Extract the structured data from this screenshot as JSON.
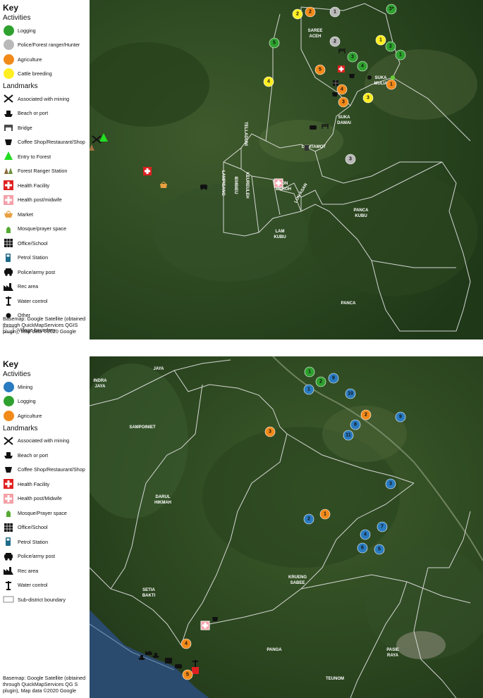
{
  "top": {
    "key_title": "Key",
    "activities_title": "Activities",
    "activities": [
      {
        "label": "Logging",
        "color": "#2ea12e"
      },
      {
        "label": "Police/Forest ranger/Hunter",
        "color": "#b9b9b9"
      },
      {
        "label": "Agriculture",
        "color": "#f28a1a"
      },
      {
        "label": "Cattle breeding",
        "color": "#ffee22"
      }
    ],
    "landmarks_title": "Landmarks",
    "landmarks": [
      {
        "label": "Associated with mining",
        "icon": "pickaxe-icon"
      },
      {
        "label": "Beach or port",
        "icon": "ship-icon"
      },
      {
        "label": "Bridge",
        "icon": "bridge-icon"
      },
      {
        "label": "Coffee Shop/Restaurant/Shop",
        "icon": "cup-icon"
      },
      {
        "label": "Entry to Forest",
        "icon": "tree-icon"
      },
      {
        "label": "Forest Ranger Station",
        "icon": "ranger-station-icon"
      },
      {
        "label": "Health Facility",
        "icon": "red-cross-icon"
      },
      {
        "label": "Health post/midwife",
        "icon": "pink-cross-icon"
      },
      {
        "label": "Market",
        "icon": "basket-icon"
      },
      {
        "label": "Mosque/prayer space",
        "icon": "mosque-icon"
      },
      {
        "label": "Office/School",
        "icon": "building-icon"
      },
      {
        "label": "Petrol Station",
        "icon": "fuel-icon"
      },
      {
        "label": "Police/army post",
        "icon": "car-icon"
      },
      {
        "label": "Rec area",
        "icon": "factory-icon"
      },
      {
        "label": "Water control",
        "icon": "tower-icon"
      },
      {
        "label": "Other",
        "icon": "dot-icon"
      },
      {
        "label": "Village boundary",
        "icon": "boundary-icon"
      }
    ],
    "basemap_note": "Basemap: Google Satellite (obtained through QuickMapServices QGIS plugin), Map data ©2020 Google",
    "village_labels": [
      "SAREE ACEH",
      "SUKA MULIA",
      "SUKA DAMAI",
      "LAMTAMOT",
      "TELLADUNI",
      "LAMPISANG",
      "IEMBIEU",
      "KEUREULEH",
      "LON BAROH",
      "LON ASAN",
      "PANCA KUBU",
      "LAM KUBU",
      "PANCA"
    ],
    "markers": [
      {
        "n": "1",
        "cat": "police"
      },
      {
        "n": "2",
        "cat": "agri"
      },
      {
        "n": "2",
        "cat": "cattle"
      },
      {
        "n": "3*",
        "cat": "logging"
      },
      {
        "n": "2",
        "cat": "police"
      },
      {
        "n": "1",
        "cat": "cattle"
      },
      {
        "n": "5",
        "cat": "logging"
      },
      {
        "n": "2",
        "cat": "logging"
      },
      {
        "n": "1",
        "cat": "logging"
      },
      {
        "n": "3",
        "cat": "logging"
      },
      {
        "n": "4",
        "cat": "logging"
      },
      {
        "n": "5",
        "cat": "agri"
      },
      {
        "n": "4",
        "cat": "cattle"
      },
      {
        "n": "1",
        "cat": "agri"
      },
      {
        "n": "4",
        "cat": "agri"
      },
      {
        "n": "3",
        "cat": "agri"
      },
      {
        "n": "3",
        "cat": "cattle"
      },
      {
        "n": "3",
        "cat": "police"
      }
    ]
  },
  "bottom": {
    "key_title": "Key",
    "activities_title": "Activities",
    "activities": [
      {
        "label": "Mining",
        "color": "#2a7bc0"
      },
      {
        "label": "Logging",
        "color": "#2ea12e"
      },
      {
        "label": "Agriculture",
        "color": "#f28a1a"
      }
    ],
    "landmarks_title": "Landmarks",
    "landmarks": [
      {
        "label": "Associated with mining",
        "icon": "pickaxe-icon"
      },
      {
        "label": "Beach or port",
        "icon": "ship-icon"
      },
      {
        "label": "Coffee Shop/Restaurant/Shop",
        "icon": "cup-icon"
      },
      {
        "label": "Health Facility",
        "icon": "red-cross-icon"
      },
      {
        "label": "Health post/Midwife",
        "icon": "pink-cross-icon"
      },
      {
        "label": "Mosque/Prayer space",
        "icon": "mosque-icon"
      },
      {
        "label": "Office/School",
        "icon": "building-icon"
      },
      {
        "label": "Petrol Station",
        "icon": "fuel-icon"
      },
      {
        "label": "Police/army post",
        "icon": "car-icon"
      },
      {
        "label": "Rec area",
        "icon": "factory-icon"
      },
      {
        "label": "Water control",
        "icon": "tower-icon"
      },
      {
        "label": "Sub-district boundary",
        "icon": "boundary-icon"
      }
    ],
    "basemap_note": "Basemap: Google Satellite (obtained through QuickMapServices QG S plugin), Map data ©2020 Google",
    "district_labels": [
      "INDRA JAYA",
      "JAYA",
      "SAMPOINIET",
      "DARUL HIKMAH",
      "KRUENG SABEE",
      "SETIA BAKTI",
      "PANGA",
      "PASIE RAYA",
      "TEUNOM"
    ],
    "markers": [
      {
        "n": "1",
        "cat": "logging"
      },
      {
        "n": "2",
        "cat": "logging"
      },
      {
        "n": "9",
        "cat": "mining"
      },
      {
        "n": "1",
        "cat": "mining"
      },
      {
        "n": "10",
        "cat": "mining"
      },
      {
        "n": "2",
        "cat": "agri"
      },
      {
        "n": "9",
        "cat": "mining"
      },
      {
        "n": "8",
        "cat": "mining"
      },
      {
        "n": "11",
        "cat": "mining"
      },
      {
        "n": "3",
        "cat": "agri"
      },
      {
        "n": "3",
        "cat": "mining"
      },
      {
        "n": "2",
        "cat": "mining"
      },
      {
        "n": "1",
        "cat": "agri"
      },
      {
        "n": "7",
        "cat": "mining"
      },
      {
        "n": "4",
        "cat": "mining"
      },
      {
        "n": "6",
        "cat": "mining"
      },
      {
        "n": "5",
        "cat": "mining"
      },
      {
        "n": "4",
        "cat": "agri"
      },
      {
        "n": "5",
        "cat": "agri"
      }
    ]
  },
  "colors": {
    "logging": "#2ea12e",
    "police": "#b9b9b9",
    "agri": "#f28a1a",
    "cattle": "#ffee22",
    "mining": "#2a7bc0"
  }
}
